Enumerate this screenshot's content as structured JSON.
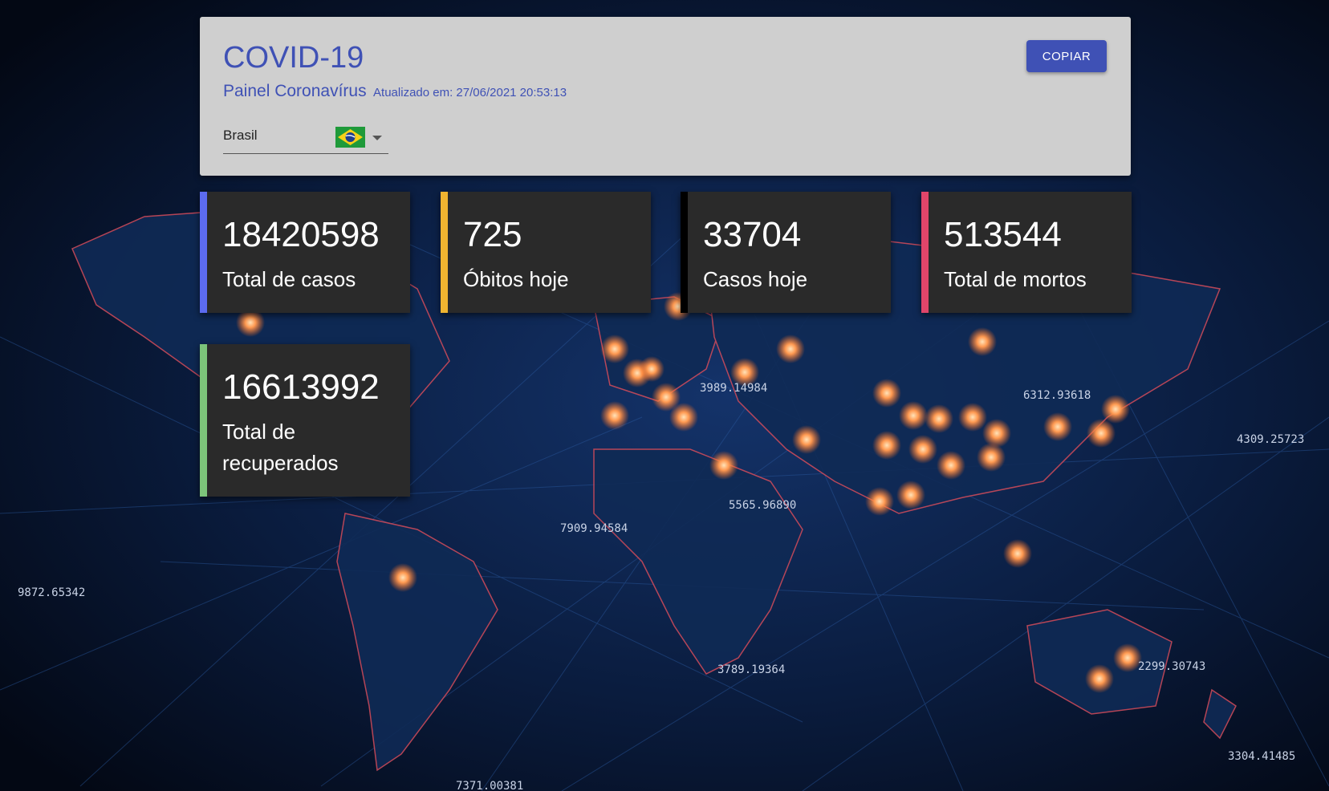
{
  "header": {
    "title": "COVID-19",
    "subtitle": "Painel Coronavírus",
    "updated": "Atualizado em: 27/06/2021 20:53:13",
    "copy_button": "COPIAR"
  },
  "country_select": {
    "value": "Brasil",
    "flag_icon": "brazil-flag-icon"
  },
  "cards": [
    {
      "value": "18420598",
      "label": "Total de casos",
      "color": "#5c6bf0"
    },
    {
      "value": "725",
      "label": "Óbitos hoje",
      "color": "#f0b430"
    },
    {
      "value": "33704",
      "label": "Casos hoje",
      "color": "#000000"
    },
    {
      "value": "513544",
      "label": "Total de mortos",
      "color": "#e0456a"
    },
    {
      "value": "16613992",
      "label": "Total de recuperados",
      "color": "#7cc47a"
    }
  ],
  "background": {
    "numbers": [
      "3989.14984",
      "6312.93618",
      "4309.25723",
      "5565.96890",
      "7909.94584",
      "9872.65342",
      "3789.19364",
      "2299.30743",
      "3304.41485",
      "7371.00381"
    ]
  }
}
